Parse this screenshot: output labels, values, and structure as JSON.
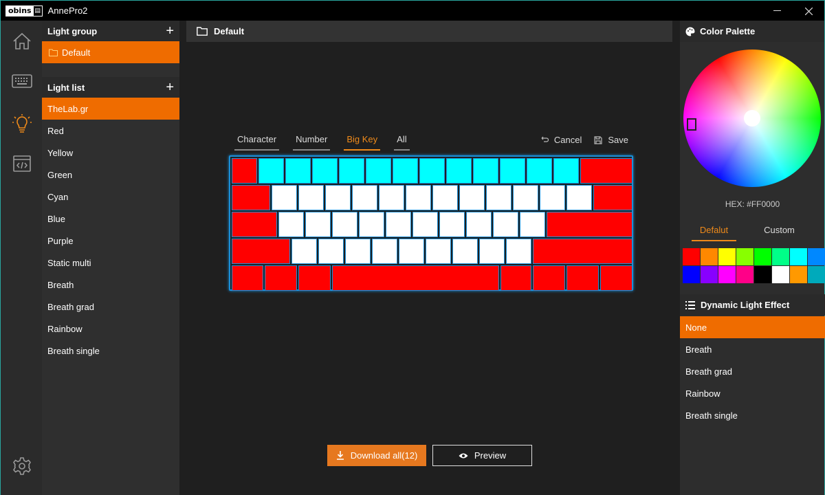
{
  "window": {
    "logo_text": "obins",
    "title": "AnnePro2",
    "minimize_glyph": "—",
    "close_glyph": "✕"
  },
  "rail": {
    "icons": [
      "home-icon",
      "keyboard-icon",
      "light-bulb-icon",
      "code-window-icon",
      "settings-gear-icon"
    ],
    "active": "light-bulb-icon"
  },
  "light_group": {
    "title": "Light group",
    "add": "+",
    "items": [
      {
        "label": "Default"
      }
    ]
  },
  "light_list": {
    "title": "Light list",
    "add": "+",
    "items": [
      {
        "label": "TheLab.gr"
      },
      {
        "label": "Red"
      },
      {
        "label": "Yellow"
      },
      {
        "label": "Green"
      },
      {
        "label": "Cyan"
      },
      {
        "label": "Blue"
      },
      {
        "label": "Purple"
      },
      {
        "label": "Static multi"
      },
      {
        "label": "Breath"
      },
      {
        "label": "Breath grad"
      },
      {
        "label": "Rainbow"
      },
      {
        "label": "Breath single"
      }
    ],
    "active_index": 0
  },
  "center": {
    "header": "Default",
    "tabs": [
      {
        "label": "Character"
      },
      {
        "label": "Number"
      },
      {
        "label": "Big Key"
      },
      {
        "label": "All"
      }
    ],
    "active_tab": 2,
    "cancel_label": "Cancel",
    "save_label": "Save",
    "download_label": "Download all(12)",
    "preview_label": "Preview"
  },
  "keyboard": {
    "colors": {
      "red": "#ff0000",
      "cyan": "#00ffff",
      "white": "#ffffff"
    },
    "rows": [
      [
        "red",
        "cyan",
        "cyan",
        "cyan",
        "cyan",
        "cyan",
        "cyan",
        "cyan",
        "cyan",
        "cyan",
        "cyan",
        "cyan",
        "cyan",
        "red"
      ],
      [
        "red",
        "white",
        "white",
        "white",
        "white",
        "white",
        "white",
        "white",
        "white",
        "white",
        "white",
        "white",
        "white",
        "red"
      ],
      [
        "red",
        "white",
        "white",
        "white",
        "white",
        "white",
        "white",
        "white",
        "white",
        "white",
        "white",
        "red"
      ],
      [
        "red",
        "white",
        "white",
        "white",
        "white",
        "white",
        "white",
        "white",
        "white",
        "white",
        "red"
      ],
      [
        "red",
        "red",
        "red",
        "red",
        "red",
        "red",
        "red",
        "red"
      ]
    ]
  },
  "palette": {
    "title": "Color Palette",
    "hex_label": "HEX: #FF0000",
    "tabs": [
      {
        "label": "Defalut"
      },
      {
        "label": "Custom"
      }
    ],
    "active_tab": 0,
    "swatches": [
      "#ff0000",
      "#ff8800",
      "#ffff00",
      "#88ff00",
      "#00ff00",
      "#00ff88",
      "#00ffff",
      "#0088ff",
      "#0000ff",
      "#8800ff",
      "#ff00ff",
      "#ff0088",
      "#000000",
      "#ffffff",
      "#ff9900",
      "#00aabb"
    ]
  },
  "dynamic": {
    "title": "Dynamic Light Effect",
    "items": [
      {
        "label": "None"
      },
      {
        "label": "Breath"
      },
      {
        "label": "Breath grad"
      },
      {
        "label": "Rainbow"
      },
      {
        "label": "Breath single"
      }
    ],
    "active_index": 0
  }
}
